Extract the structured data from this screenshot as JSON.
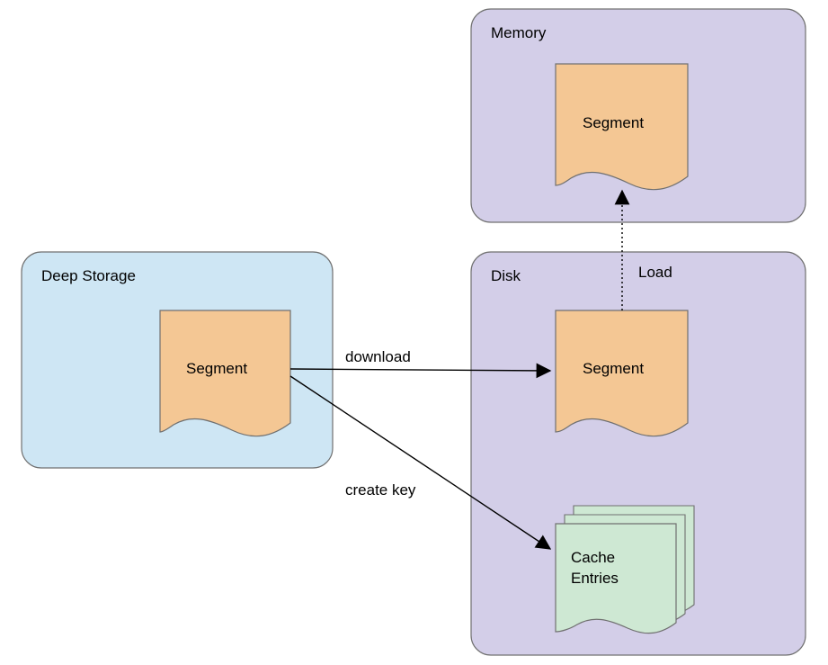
{
  "deepStorage": {
    "title": "Deep Storage",
    "segment": "Segment"
  },
  "memory": {
    "title": "Memory",
    "segment": "Segment"
  },
  "disk": {
    "title": "Disk",
    "segment": "Segment",
    "cache_line1": "Cache",
    "cache_line2": "Entries"
  },
  "arrows": {
    "download": "download",
    "createKey": "create key",
    "load": "Load"
  },
  "colors": {
    "deepStorageFill": "#cee6f4",
    "memoryDiskFill": "#d3cee8",
    "segmentFill": "#f4c794",
    "cacheFill": "#cee8d3",
    "stroke": "#707070"
  }
}
